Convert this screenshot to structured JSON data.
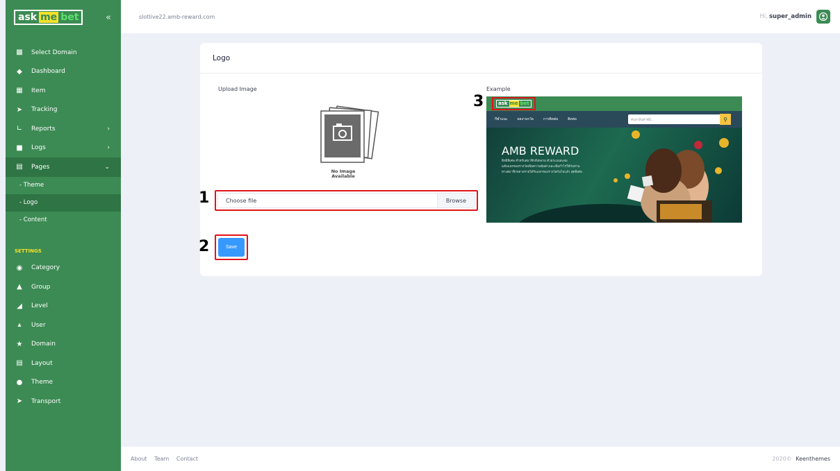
{
  "brand": {
    "ask": "ask",
    "me": "me",
    "bet": "bet",
    "collapse_icon": "double-chevron-left-icon"
  },
  "header": {
    "domain": "slotlive22.amb-reward.com",
    "greeting": "Hi,",
    "username": "super_admin"
  },
  "sidebar": {
    "items": [
      {
        "label": "Select Domain",
        "icon": "domain-select-icon"
      },
      {
        "label": "Dashboard",
        "icon": "diamond-icon"
      },
      {
        "label": "Item",
        "icon": "table-icon"
      },
      {
        "label": "Tracking",
        "icon": "send-icon"
      },
      {
        "label": "Reports",
        "icon": "chart-icon"
      },
      {
        "label": "Logs",
        "icon": "folder-icon"
      },
      {
        "label": "Pages",
        "icon": "page-icon"
      }
    ],
    "pages_sub": [
      "- Theme",
      "- Logo",
      "- Content"
    ],
    "settings_label": "SETTINGS",
    "settings": [
      {
        "label": "Category",
        "icon": "box-icon"
      },
      {
        "label": "Group",
        "icon": "group-icon"
      },
      {
        "label": "Level",
        "icon": "level-icon"
      },
      {
        "label": "User",
        "icon": "user-icon"
      },
      {
        "label": "Domain",
        "icon": "star-icon"
      },
      {
        "label": "Layout",
        "icon": "layout-icon"
      },
      {
        "label": "Theme",
        "icon": "theme-icon"
      },
      {
        "label": "Transport",
        "icon": "send-icon"
      }
    ]
  },
  "card": {
    "title": "Logo",
    "upload_label": "Upload Image",
    "no_image_line1": "No Image",
    "no_image_line2": "Available",
    "file_placeholder": "Choose file",
    "browse": "Browse",
    "save": "Save",
    "example_label": "Example",
    "steps": [
      "1",
      "2",
      "3"
    ]
  },
  "example": {
    "nav": [
      "กีฬาแนะ",
      "ผลงานรวัล",
      "การติดต่อ",
      "ติดต่อ"
    ],
    "search_placeholder": "ค้นหาสินค้าที่นี่...",
    "banner_title": "AMB REWARD",
    "banner_lines": [
      "สิทธิพิเศษ สำหรับสมาชิกทั้งหลาย ด้วยระบบสะสม",
      "แต้มแลกของรางวัลเพิ่มความคุ้มค่าและเพิ่มกำไรให้กับท่าน",
      "ทางสมาชิกหลายรายได้รับแจกของรางวัลกันไปแล้ว สุดพิเศษ"
    ]
  },
  "footer": {
    "links": [
      "About",
      "Team",
      "Contact"
    ],
    "year": "2020©",
    "org": "Keenthemes"
  }
}
